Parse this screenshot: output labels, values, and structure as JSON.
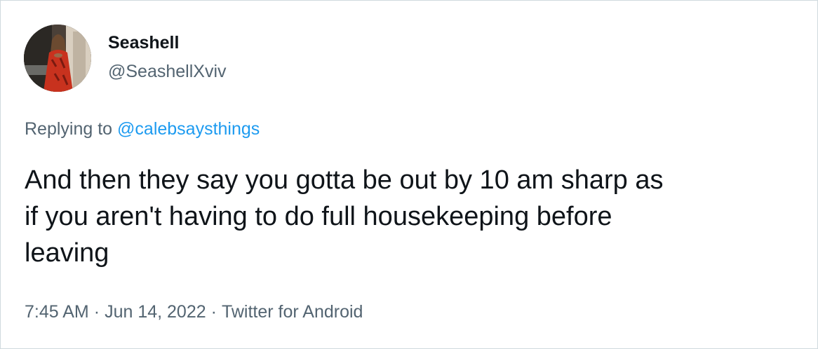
{
  "author": {
    "display_name": "Seashell",
    "handle": "@SeashellXviv",
    "avatar_icon": "profile-photo"
  },
  "reply": {
    "prefix": "Replying to ",
    "mention": "@calebsaysthings"
  },
  "tweet": {
    "text": "And then they say you gotta be out by 10 am sharp as\nif you aren't having to do full housekeeping before\nleaving"
  },
  "meta": {
    "time": "7:45 AM",
    "separator": "·",
    "date": "Jun 14, 2022",
    "source": "Twitter for Android"
  },
  "colors": {
    "text_primary": "#0f1419",
    "text_secondary": "#536471",
    "link": "#1d9bf0",
    "border": "#cfd9de"
  }
}
